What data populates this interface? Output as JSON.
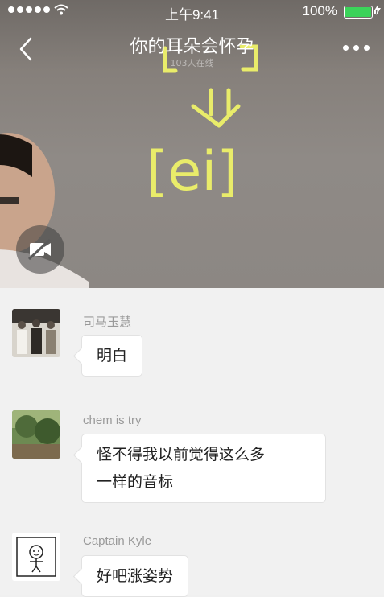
{
  "status_bar": {
    "time": "上午9:41",
    "battery": "100%"
  },
  "header": {
    "title": "你的耳朵会怀孕",
    "subtitle": "103人在线"
  },
  "video": {
    "board_text": "[ei]",
    "camera_icon": "video-off-icon"
  },
  "messages": [
    {
      "name": "司马玉慧",
      "text": "明白"
    },
    {
      "name": "chem is try",
      "text_line1": "怪不得我以前觉得这么多",
      "text_line2": "一样的音标"
    },
    {
      "name": "Captain Kyle",
      "text": "好吧涨姿势"
    }
  ],
  "colors": {
    "battery_fill": "#3bd35a",
    "board_chalk": "#e9ec6a"
  }
}
